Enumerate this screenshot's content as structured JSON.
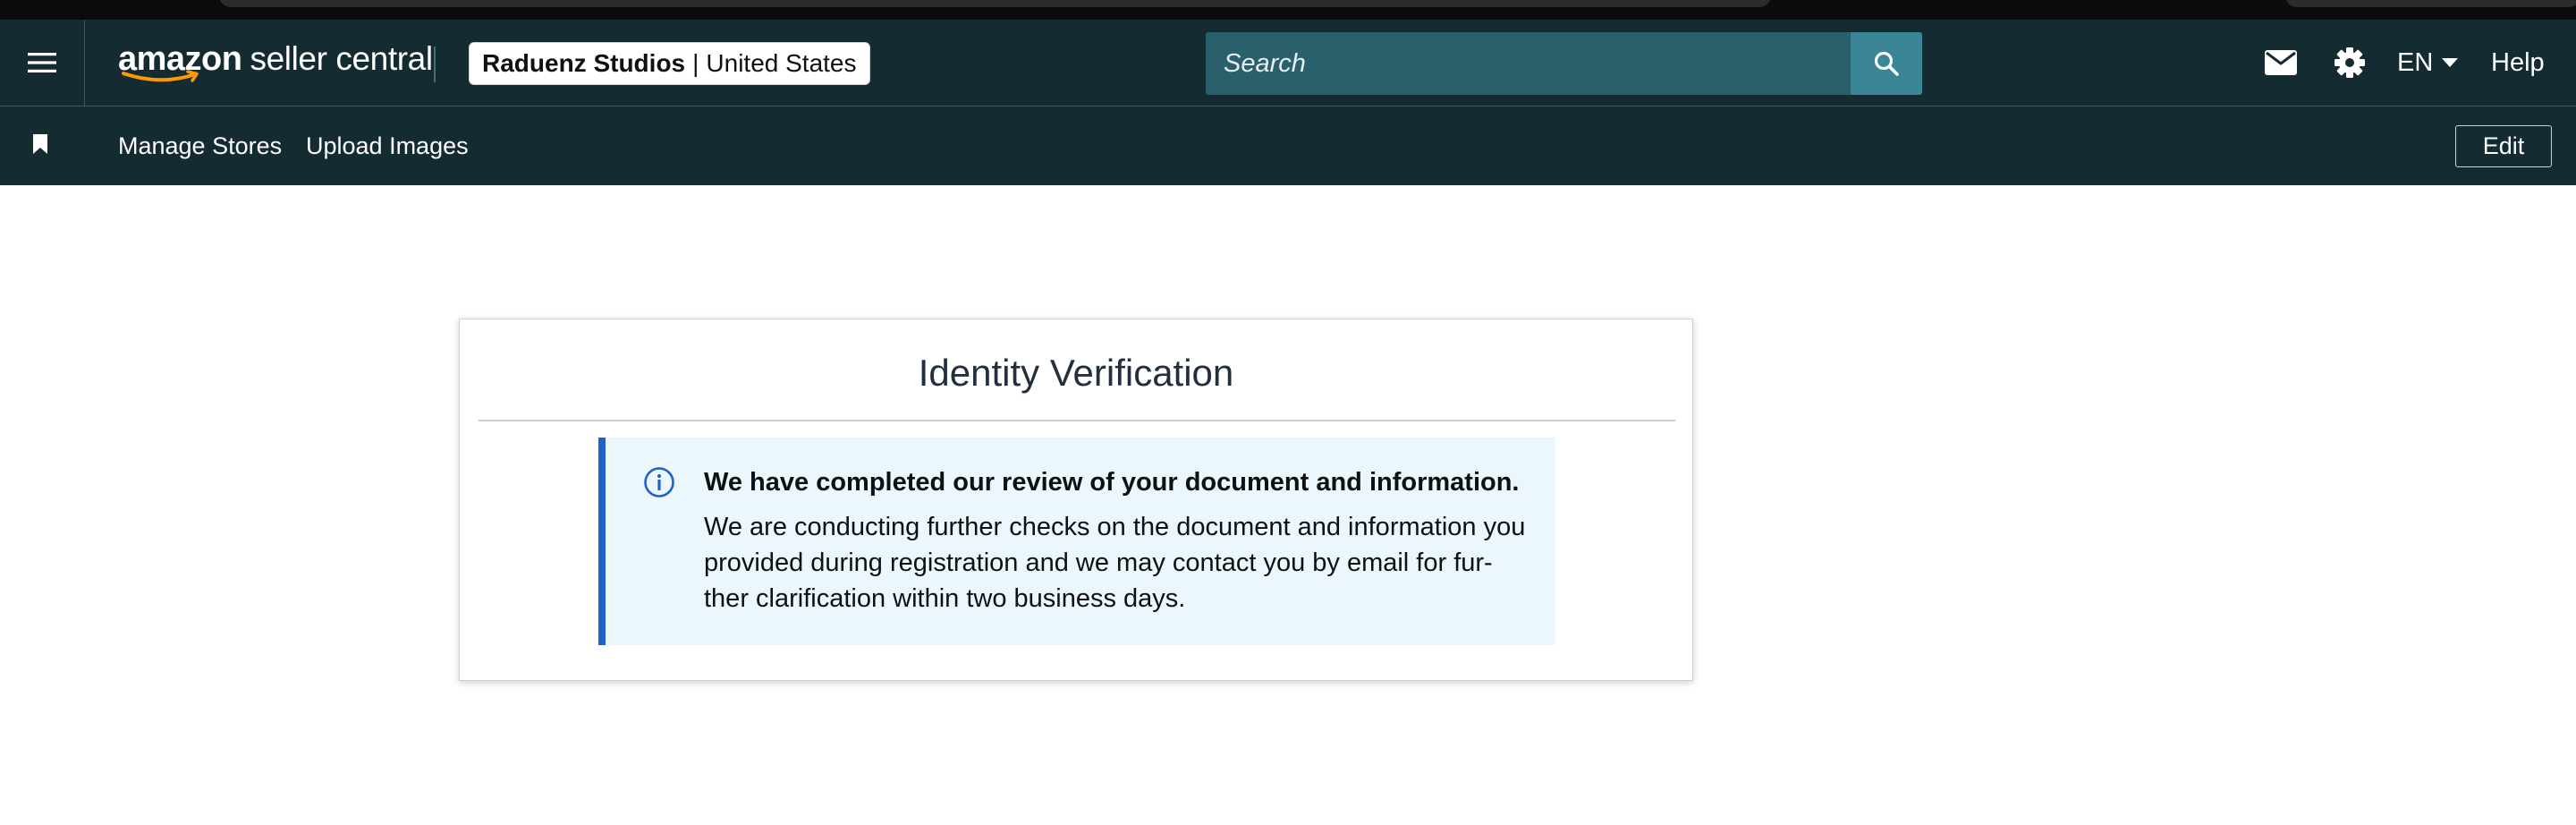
{
  "header": {
    "logo_amazon": "amazon",
    "logo_seller_central": "seller central",
    "store_name": "Raduenz Studios",
    "store_separator": "|",
    "store_region": "United States",
    "search_placeholder": "Search",
    "language": "EN",
    "help_label": "Help",
    "icons": [
      "menu-icon",
      "search-icon",
      "mail-icon",
      "gear-icon",
      "caret-down-icon"
    ]
  },
  "subnav": {
    "items": [
      {
        "label": "Manage Stores"
      },
      {
        "label": "Upload Images"
      }
    ],
    "edit_label": "Edit",
    "icons": [
      "bookmark-icon"
    ]
  },
  "card": {
    "title": "Identity Verification",
    "alert": {
      "heading": "We have completed our review of your document and information.",
      "body_lines": [
        "We are conducting further checks on the document and information you",
        "provided during registration and we may contact you by email for fur-",
        "ther clarification within two business days."
      ],
      "icon": "info-icon"
    }
  },
  "colors": {
    "header_bg": "#152b32",
    "search_bg": "#2a5f6c",
    "search_button": "#3a8696",
    "alert_bg": "#ecf6fd",
    "alert_accent": "#2162c8",
    "logo_smile": "#ff9900"
  }
}
